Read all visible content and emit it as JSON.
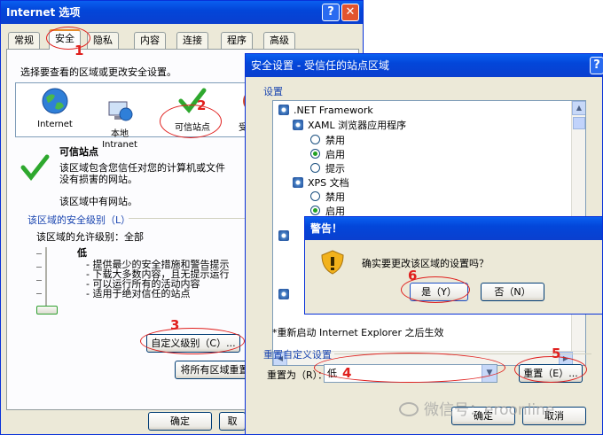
{
  "inet": {
    "title": "Internet 选项",
    "help_glyph": "?",
    "close_glyph": "✕",
    "tabs": [
      "常规",
      "安全",
      "隐私",
      "内容",
      "连接",
      "程序",
      "高级"
    ],
    "zone_prompt": "选择要查看的区域或更改安全设置。",
    "zones": [
      {
        "label": "Internet"
      },
      {
        "label": "本地\nIntranet"
      },
      {
        "label": "可信站点"
      },
      {
        "label": "受限"
      }
    ],
    "zone_title": "可信站点",
    "zone_desc": "该区域包含您信任对您的计算机或文件没有损害的网站。",
    "zone_sites": "该区域中有网站。",
    "level_group": "该区域的安全级别（L）",
    "allowed_levels": "该区域的允许级别：全部",
    "level_name": "低",
    "level_bullets": [
      "- 提供最少的安全措施和警告提示",
      "- 下载大多数内容，且无提示运行",
      "- 可以运行所有的活动内容",
      "- 适用于绝对信任的站点"
    ],
    "custom_level_btn": "自定义级别（C）...",
    "default_all_btn": "将所有区域重置",
    "ok_btn": "确定",
    "cancel_partial": "取"
  },
  "sec": {
    "title": "安全设置 - 受信任的站点区域",
    "settings_label": "设置",
    "items": [
      {
        "type": "header",
        "text": ".NET Framework"
      },
      {
        "type": "sub",
        "text": "XAML 浏览器应用程序"
      },
      {
        "type": "radio",
        "text": "禁用",
        "on": false
      },
      {
        "type": "radio",
        "text": "启用",
        "on": true
      },
      {
        "type": "radio",
        "text": "提示",
        "on": false
      },
      {
        "type": "sub",
        "text": "XPS 文档"
      },
      {
        "type": "radio",
        "text": "禁用",
        "on": false
      },
      {
        "type": "radio",
        "text": "启用",
        "on": true
      }
    ],
    "restart_note": "*重新启动 Internet Explorer 之后生效",
    "reset_group": "重置自定义设置",
    "reset_to_label": "重置为（R）：",
    "reset_value": "低",
    "reset_btn": "重置（E）...",
    "ok_btn": "确定",
    "cancel_btn": "取消"
  },
  "warn": {
    "title": "警告！",
    "message": "确实要更改该区域的设置吗？",
    "yes_btn": "是（Y）",
    "no_btn": "否（N）"
  },
  "annotations": [
    "1",
    "2",
    "3",
    "4",
    "5",
    "6"
  ],
  "watermark": "微信号：eroonline"
}
